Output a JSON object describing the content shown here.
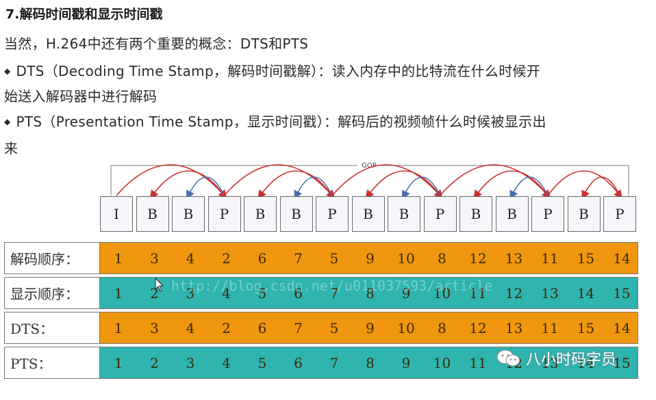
{
  "heading": "7.解码时间戳和显示时间戳",
  "intro": "当然，H.264中还有两个重要的概念：DTS和PTS",
  "dts_line1": "DTS（Decoding Time Stamp，解码时间戳解）：读入内存中的比特流在什么时候开",
  "dts_line2": "始送入解码器中进行解码",
  "pts_line1": "PTS（Presentation Time Stamp，显示时间戳）：解码后的视频帧什么时候被显示出",
  "pts_line2": "来",
  "diagram": {
    "gop_label": "GOP",
    "frames": [
      "I",
      "B",
      "B",
      "P",
      "B",
      "B",
      "P",
      "B",
      "B",
      "P",
      "B",
      "B",
      "P",
      "B",
      "P"
    ],
    "rows": [
      {
        "label": "解码顺序：",
        "values": [
          "1",
          "3",
          "4",
          "2",
          "6",
          "7",
          "5",
          "9",
          "10",
          "8",
          "12",
          "13",
          "11",
          "15",
          "14"
        ],
        "color": "#f0960f"
      },
      {
        "label": "显示顺序：",
        "values": [
          "1",
          "2",
          "3",
          "4",
          "5",
          "6",
          "7",
          "8",
          "9",
          "10",
          "11",
          "12",
          "13",
          "14",
          "15"
        ],
        "color": "#2fb4b0"
      },
      {
        "label": "DTS：",
        "values": [
          "1",
          "3",
          "4",
          "2",
          "6",
          "7",
          "5",
          "9",
          "10",
          "8",
          "12",
          "13",
          "11",
          "15",
          "14"
        ],
        "color": "#f0960f"
      },
      {
        "label": "PTS：",
        "values": [
          "1",
          "2",
          "3",
          "4",
          "5",
          "6",
          "7",
          "8",
          "9",
          "10",
          "11",
          "12",
          "13",
          "14",
          "15"
        ],
        "color": "#2fb4b0"
      }
    ]
  },
  "watermark": "八小时码字员",
  "faint_url": "http://blog.csdn.net/u011037593/article"
}
